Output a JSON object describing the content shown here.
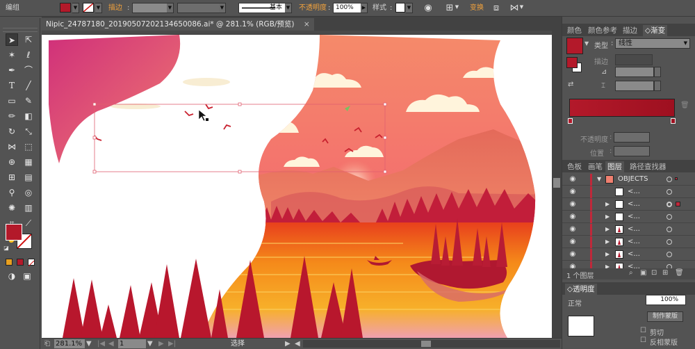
{
  "control_bar": {
    "mode_label": "编组",
    "stroke_label": "描边",
    "stroke_value": "",
    "style_line_label": "基本",
    "opacity_label": "不透明度",
    "opacity_value": "100%",
    "style_label": "样式",
    "transform_label": "变换",
    "fill_color": "#b3192a"
  },
  "document": {
    "tab_title": "Nipic_24787180_20190507202134650086.ai* @ 281.1% (RGB/预览)",
    "close_glyph": "×"
  },
  "status_bar": {
    "zoom": "281.1%",
    "artboard": "1",
    "tool": "选择"
  },
  "gradient_panel": {
    "tabs": [
      "颜色",
      "颜色参考",
      "描边",
      "渐变"
    ],
    "active_tab": "渐变",
    "type_label": "类型",
    "type_value": "线性",
    "stroke_label": "描边",
    "opacity_label": "不透明度",
    "position_label": "位置",
    "gradient_start": "#b3192a",
    "gradient_end": "#9e1020"
  },
  "layers_panel": {
    "tabs": [
      "色板",
      "画笔",
      "图层",
      "路径查找器"
    ],
    "active_tab": "图层",
    "rows": [
      {
        "name": "OBJECTS"
      },
      {
        "name": "<..."
      },
      {
        "name": "<..."
      },
      {
        "name": "<..."
      },
      {
        "name": "<..."
      },
      {
        "name": "<..."
      },
      {
        "name": "<..."
      },
      {
        "name": "<..."
      }
    ],
    "footer": "1 个图层"
  },
  "transparency_panel": {
    "title": "透明度",
    "opacity_value": "100%",
    "blend_label": "正常",
    "make_mask_label": "制作蒙版",
    "clip_label": "剪切",
    "invert_label": "反相蒙版"
  },
  "colors": {
    "accent": "#b3192a",
    "ui_bg": "#535353",
    "ui_dark": "#424242"
  }
}
